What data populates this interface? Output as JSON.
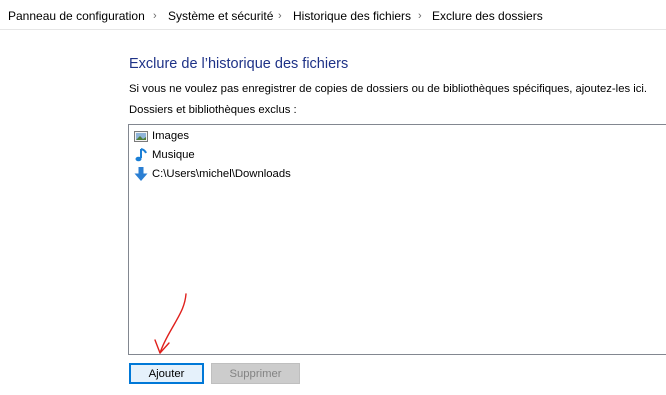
{
  "breadcrumb": {
    "items": [
      {
        "label": "Panneau de configuration"
      },
      {
        "label": "Système et sécurité"
      },
      {
        "label": "Historique des fichiers"
      },
      {
        "label": "Exclure des dossiers"
      }
    ],
    "separator": "›"
  },
  "main": {
    "title": "Exclure de l’historique des fichiers",
    "instructions": "Si vous ne voulez pas enregistrer de copies de dossiers ou de bibliothèques spécifiques, ajoutez-les ici.",
    "list_label": "Dossiers et bibliothèques exclus :",
    "excluded_items": [
      {
        "label": "Images",
        "icon": "images-library-icon"
      },
      {
        "label": "Musique",
        "icon": "music-library-icon"
      },
      {
        "label": "C:\\Users\\michel\\Downloads",
        "icon": "downloads-folder-icon"
      }
    ]
  },
  "buttons": {
    "add_label": "Ajouter",
    "remove_label": "Supprimer"
  },
  "colors": {
    "title": "#1e3287",
    "focus_border": "#0078d7",
    "annotation": "#e0201c"
  }
}
